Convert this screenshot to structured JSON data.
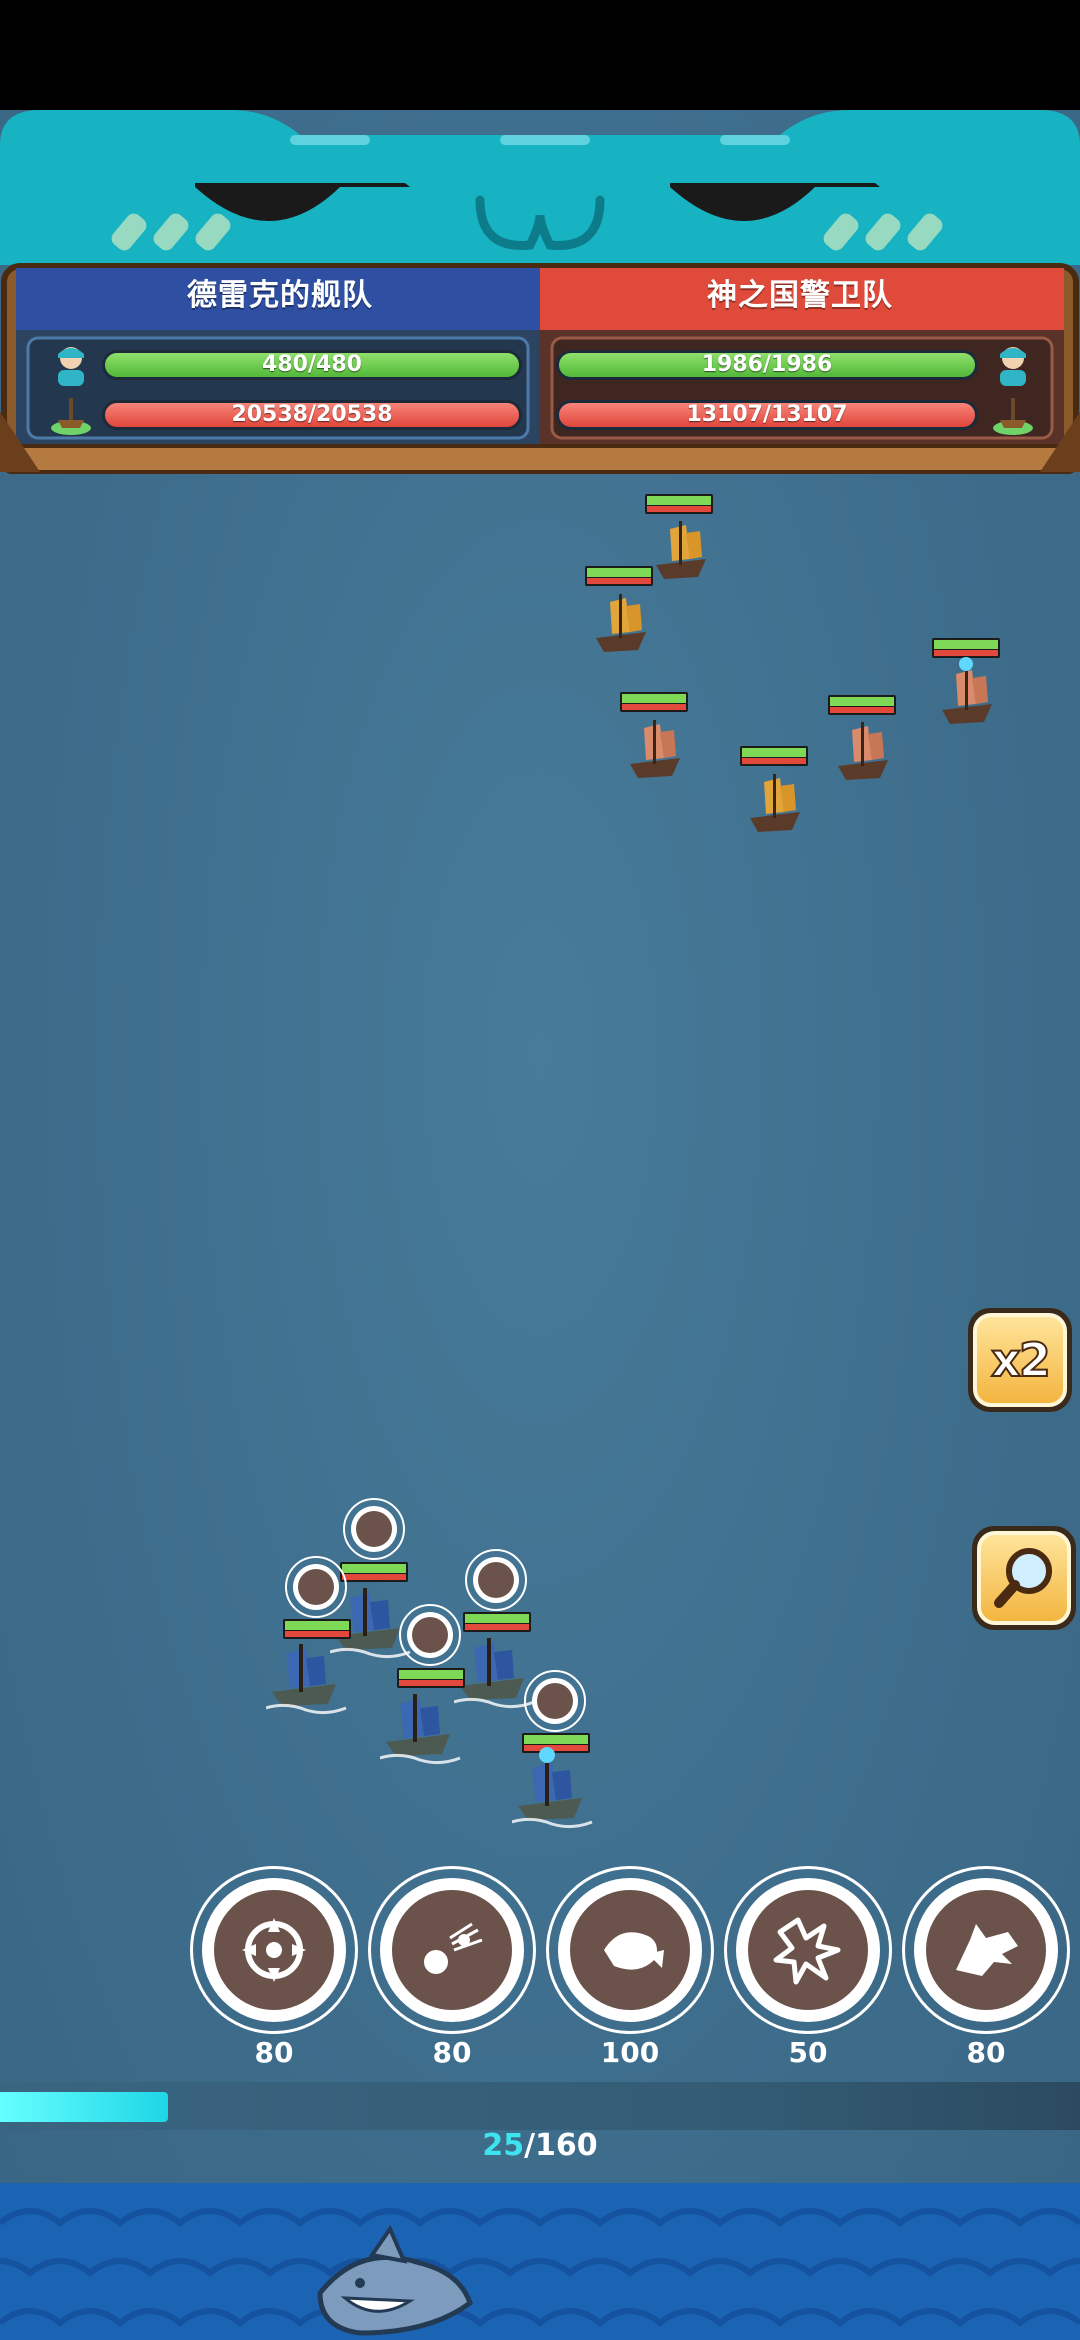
{
  "teams": {
    "left": {
      "name": "德雷克的舰队",
      "crew": "480/480",
      "ships": "20538/20538"
    },
    "right": {
      "name": "神之国警卫队",
      "crew": "1986/1986",
      "ships": "13107/13107"
    }
  },
  "skills": [
    {
      "icon": "crosshair-icon",
      "cost": "80"
    },
    {
      "icon": "cannonball-icon",
      "cost": "80"
    },
    {
      "icon": "fish-icon",
      "cost": "100"
    },
    {
      "icon": "explosion-icon",
      "cost": "50"
    },
    {
      "icon": "wolf-head-icon",
      "cost": "80"
    }
  ],
  "energy": {
    "current": "25",
    "separator": "/",
    "max": "160",
    "fill_fraction": 0.156
  },
  "side_buttons": {
    "speed_label": "x2"
  },
  "colors": {
    "ocean": "#3e6d8c",
    "ally_banner": "#2f4fa3",
    "enemy_banner": "#e04a3a",
    "energy": "#3ee3ee"
  }
}
